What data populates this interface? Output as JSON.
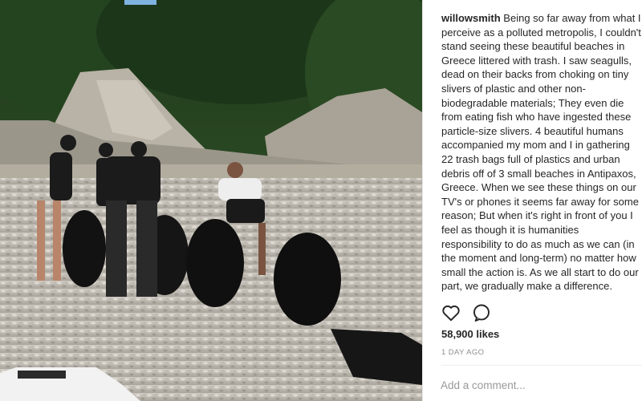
{
  "post": {
    "username": "willowsmith",
    "caption": "Being so far away from what I perceive as a polluted metropolis, I couldn't stand seeing these beautiful beaches in Greece littered with trash. I saw seagulls, dead on their backs from choking on tiny slivers of plastic and other non-biodegradable materials; They even die from eating fish who have ingested these particle-size slivers. 4 beautiful humans accompanied my mom and I in gathering 22 trash bags full of plastics and urban debris off of 3 small beaches in Antipaxos, Greece. When we see these things on our TV's or phones it seems far away for some reason; But when it's right in front of you I feel as though it is humanities responsibility to do as much as we can (in the moment and long-term) no matter how small the action is. As we all start to do our part, we gradually make a difference.",
    "likes": "58,900 likes",
    "time": "1 DAY AGO",
    "comment_placeholder": "Add a comment..."
  },
  "icons": {
    "like": "heart-icon",
    "comment": "comment-icon"
  },
  "colors": {
    "text": "#262626",
    "muted": "#8e8e8e"
  }
}
